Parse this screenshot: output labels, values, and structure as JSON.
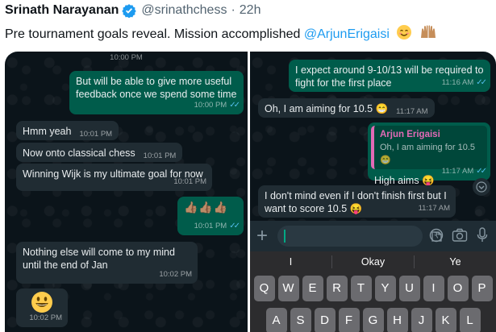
{
  "tweet": {
    "author_name": "Srinath Narayanan",
    "handle": "@srinathchess",
    "separator": "·",
    "time_ago": "22h",
    "text_prefix": "Pre tournament goals reveal. Mission accomplished ",
    "mention": "@ArjunErigaisi",
    "emojis": [
      "smiling-face-icon",
      "raised-hands-icon"
    ],
    "colors": {
      "link": "#1d9bf0",
      "verified": "#1d9bf0"
    }
  },
  "left_chat": {
    "top_time": "10:00 PM",
    "messages": [
      {
        "dir": "out",
        "text": "But will be able to give more useful feedback once we spend some time",
        "time": "10:00 PM"
      },
      {
        "dir": "in",
        "text": "Hmm yeah",
        "time": "10:01 PM"
      },
      {
        "dir": "in",
        "text": "Now onto classical chess",
        "time": "10:01 PM"
      },
      {
        "dir": "in",
        "text": "Winning Wijk is my ultimate goal for now",
        "time": "10:01 PM"
      },
      {
        "dir": "out",
        "text": "👍🏽👍🏽👍🏽",
        "time": "10:01 PM"
      },
      {
        "dir": "in",
        "text": "Nothing else will come to my mind until the end of Jan",
        "time": "10:02 PM"
      },
      {
        "dir": "in",
        "text": "😃",
        "time": "10:02 PM"
      }
    ]
  },
  "right_chat": {
    "messages": [
      {
        "dir": "out",
        "text": "I expect around 9-10/13 will be required to fight for the first place",
        "time": "11:16 AM"
      },
      {
        "dir": "in",
        "text": "Oh, I am aiming for 10.5 😁",
        "time": "11:17 AM"
      },
      {
        "dir": "out",
        "reply_author": "Arjun Erigaisi",
        "reply_text": "Oh, I am aiming for 10.5 😁",
        "text": "High aims 😝",
        "time": "11:17 AM"
      },
      {
        "dir": "in",
        "text": "I don't mind even if I don't finish first but I want to score 10.5 😝",
        "time": "11:17 AM"
      }
    ],
    "input": {
      "value": ""
    },
    "suggestions": [
      "I",
      "Okay",
      "Ye"
    ],
    "keys_row1": [
      "Q",
      "W",
      "E",
      "R",
      "T",
      "Y",
      "U",
      "I",
      "O",
      "P"
    ],
    "keys_row2": [
      "A",
      "S",
      "D",
      "F",
      "G",
      "H",
      "J",
      "K",
      "L"
    ]
  },
  "chat_colors": {
    "background": "#0b141a",
    "incoming": "#202c33",
    "outgoing": "#005c4b",
    "read_ticks": "#53bdeb"
  }
}
